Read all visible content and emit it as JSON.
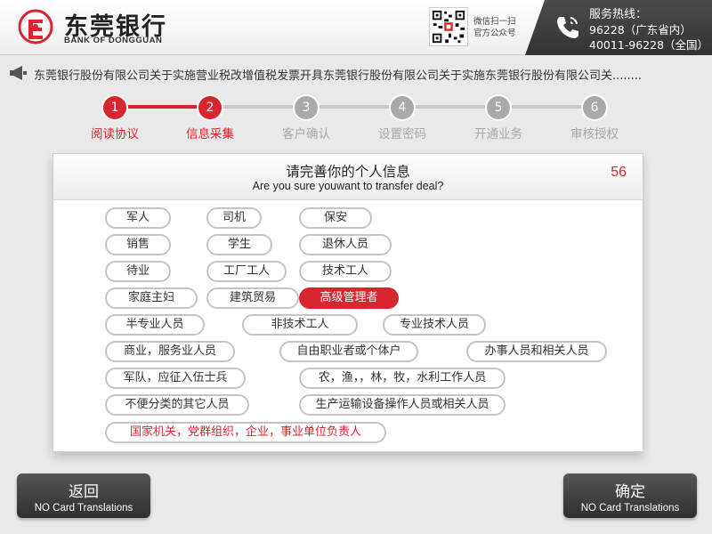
{
  "header": {
    "bank_name_cn": "东莞银行",
    "bank_name_en": "BANK OF DONGGUAN",
    "qr_caption_line1": "微信扫一扫",
    "qr_caption_line2": "官方公众号",
    "hotline_title": "服务热线：",
    "hotline_1": "96228（广东省内）",
    "hotline_2": "40011-96228（全国）",
    "logo_icon": "bank-logo-icon",
    "phone_icon": "phone-icon",
    "brand_color": "#d7262f"
  },
  "notice": {
    "icon": "megaphone-icon",
    "text": "东莞银行股份有限公司关于实施营业税改增值税发票开具东莞银行股份有限公司关于实施东莞银行股份有限公司关........"
  },
  "steps": [
    {
      "number": "1",
      "label": "阅读协议",
      "state": "done"
    },
    {
      "number": "2",
      "label": "信息采集",
      "state": "current"
    },
    {
      "number": "3",
      "label": "客户确认",
      "state": "pending"
    },
    {
      "number": "4",
      "label": "设置密码",
      "state": "pending"
    },
    {
      "number": "5",
      "label": "开通业务",
      "state": "pending"
    },
    {
      "number": "6",
      "label": "审核授权",
      "state": "pending"
    }
  ],
  "panel": {
    "title": "请完善你的个人信息",
    "subtitle": "Are you sure youwant to transfer deal?",
    "countdown": "56"
  },
  "occupations": [
    "军人",
    "司机",
    "保安",
    "销售",
    "学生",
    "退休人员",
    "待业",
    "工厂工人",
    "技术工人",
    "家庭主妇",
    "建筑贸易",
    "高级管理者",
    "半专业人员",
    "非技术工人",
    "专业技术人员",
    "商业，服务业人员",
    "自由职业者或个体户",
    "办事人员和相关人员",
    "军队，应征入伍士兵",
    "农，渔，，林，牧，水利工作人员",
    "不便分类的其它人员",
    "生产运输设备操作人员或相关人员",
    "国家机关，党群组织，企业，事业单位负责人"
  ],
  "selected_occupation": "高级管理者",
  "buttons": {
    "back_label": "返回",
    "back_sub": "NO Card Translations",
    "confirm_label": "确定",
    "confirm_sub": "NO Card Translations"
  }
}
